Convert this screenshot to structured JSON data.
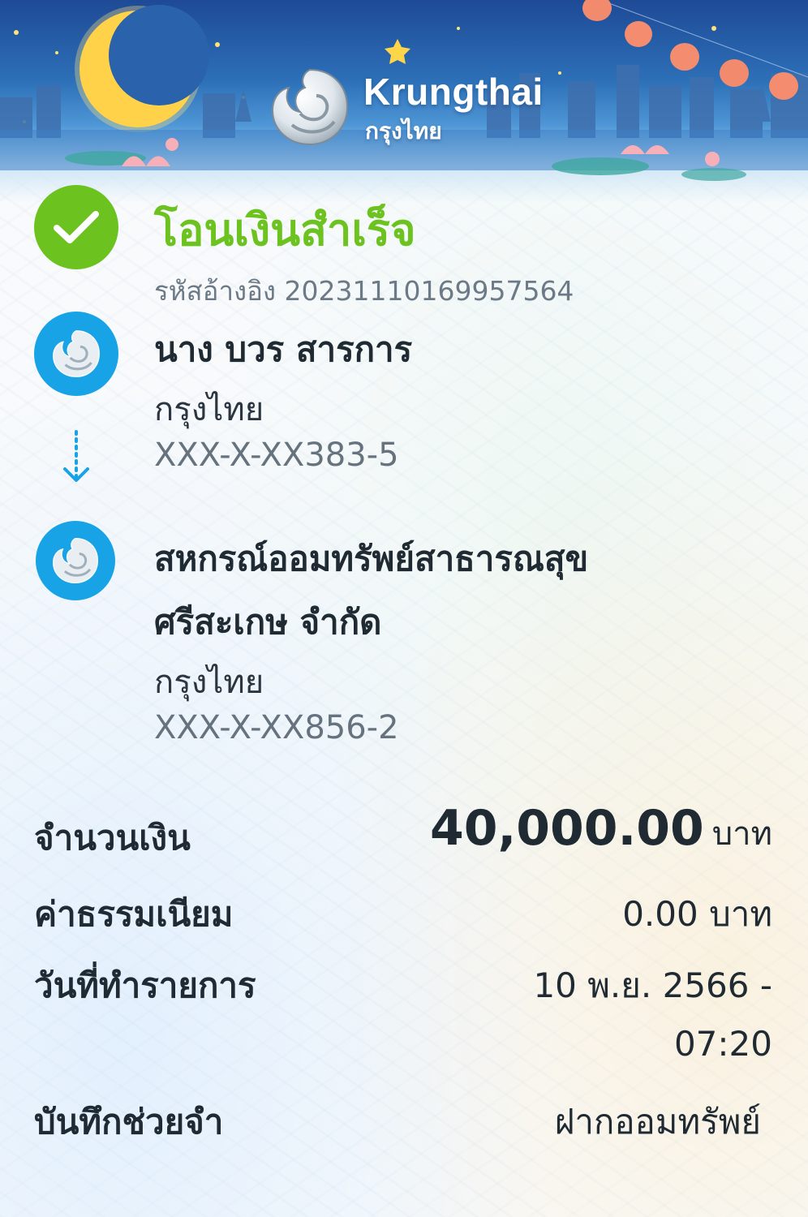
{
  "brand": {
    "name_en": "Krungthai",
    "name_th": "กรุงไทย",
    "logo_icon": "krungthai-phoenix-logo"
  },
  "status": {
    "title": "โอนเงินสำเร็จ",
    "icon": "check-icon",
    "color": "#6cc21e",
    "reference": "รหัสอ้างอิง 2023111016995756­4"
  },
  "sender": {
    "name": "นาง บวร สารการ",
    "bank": "กรุงไทย",
    "account": "XXX-X-XX383-5"
  },
  "receiver": {
    "name_line1": "สหกรณ์ออมทรัพย์สาธารณสุข",
    "name_line2": "ศรีสะเกษ จำกัด",
    "bank": "กรุงไทย",
    "account": "XXX-X-XX856-2"
  },
  "details": {
    "amount_label": "จำนวนเงิน",
    "amount_value": "40,000.00",
    "amount_unit": "บาท",
    "fee_label": "ค่าธรรมเนียม",
    "fee_value": "0.00 บาท",
    "date_label": "วันที่ทำรายการ",
    "date_value_line1": "10 พ.ย. 2566 -",
    "date_value_line2": "07:20",
    "memo_label": "บันทึกช่วยจำ",
    "memo_value": "ฝากออมทรัพย์"
  },
  "colors": {
    "accent_blue": "#17a3e6",
    "success_green": "#6cc21e",
    "header_blue": "#1e4a96"
  }
}
